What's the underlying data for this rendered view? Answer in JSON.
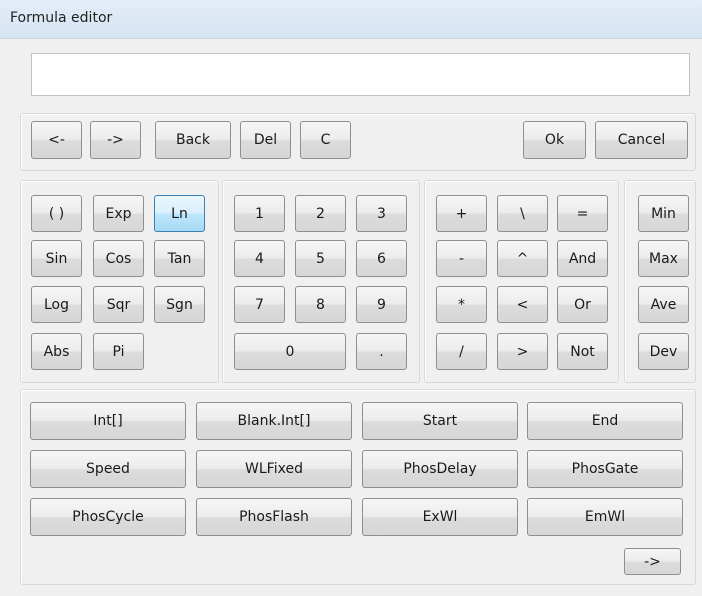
{
  "window": {
    "title": "Formula editor"
  },
  "formula": {
    "value": ""
  },
  "toolbar": {
    "cursor_left": "<-",
    "cursor_right": "->",
    "back": "Back",
    "del": "Del",
    "clear": "C",
    "ok": "Ok",
    "cancel": "Cancel"
  },
  "functions": {
    "paren": "( )",
    "exp": "Exp",
    "ln": "Ln",
    "sin": "Sin",
    "cos": "Cos",
    "tan": "Tan",
    "log": "Log",
    "sqr": "Sqr",
    "sgn": "Sgn",
    "abs": "Abs",
    "pi": "Pi"
  },
  "digits": {
    "d1": "1",
    "d2": "2",
    "d3": "3",
    "d4": "4",
    "d5": "5",
    "d6": "6",
    "d7": "7",
    "d8": "8",
    "d9": "9",
    "d0": "0",
    "dot": "."
  },
  "operators": {
    "plus": "+",
    "backslash": "\\",
    "equals": "=",
    "minus": "-",
    "power": "^",
    "and": "And",
    "multiply": "*",
    "less": "<",
    "or": "Or",
    "divide": "/",
    "greater": ">",
    "not": "Not"
  },
  "aggregates": {
    "min": "Min",
    "max": "Max",
    "ave": "Ave",
    "dev": "Dev"
  },
  "variables": {
    "int": "Int[]",
    "blank_int": "Blank.Int[]",
    "start": "Start",
    "end": "End",
    "speed": "Speed",
    "wlfixed": "WLFixed",
    "phosdelay": "PhosDelay",
    "phosgate": "PhosGate",
    "phoscycle": "PhosCycle",
    "phosflash": "PhosFlash",
    "exwl": "ExWl",
    "emwl": "EmWl",
    "next": "->"
  }
}
